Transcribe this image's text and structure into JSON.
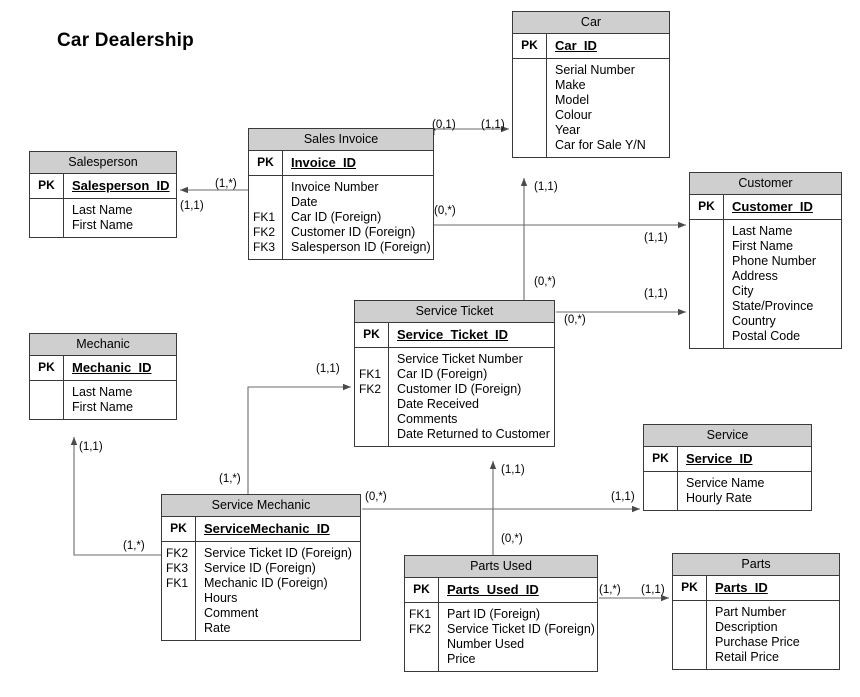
{
  "title": "Car Dealership",
  "colors": {
    "header_fill": "#cfcfcf",
    "border": "#3a3a3a",
    "line": "#6b6b6b",
    "text": "#000000",
    "background": "#ffffff"
  },
  "entities": {
    "salesperson": {
      "name": "Salesperson",
      "pk_tag": "PK",
      "pk_name": "Salesperson_ID",
      "attributes": [
        {
          "key": "",
          "name": "Last Name"
        },
        {
          "key": "",
          "name": "First Name"
        }
      ]
    },
    "sales_invoice": {
      "name": "Sales Invoice",
      "pk_tag": "PK",
      "pk_name": "Invoice_ID",
      "attributes": [
        {
          "key": "",
          "name": "Invoice Number"
        },
        {
          "key": "",
          "name": "Date"
        },
        {
          "key": "FK1",
          "name": "Car ID (Foreign)"
        },
        {
          "key": "FK2",
          "name": "Customer ID (Foreign)"
        },
        {
          "key": "FK3",
          "name": "Salesperson ID (Foreign)"
        }
      ]
    },
    "car": {
      "name": "Car",
      "pk_tag": "PK",
      "pk_name": "Car_ID",
      "attributes": [
        {
          "key": "",
          "name": "Serial Number"
        },
        {
          "key": "",
          "name": "Make"
        },
        {
          "key": "",
          "name": "Model"
        },
        {
          "key": "",
          "name": "Colour"
        },
        {
          "key": "",
          "name": "Year"
        },
        {
          "key": "",
          "name": "Car for Sale Y/N"
        }
      ]
    },
    "customer": {
      "name": "Customer",
      "pk_tag": "PK",
      "pk_name": "Customer_ID",
      "attributes": [
        {
          "key": "",
          "name": "Last Name"
        },
        {
          "key": "",
          "name": "First Name"
        },
        {
          "key": "",
          "name": "Phone Number"
        },
        {
          "key": "",
          "name": "Address"
        },
        {
          "key": "",
          "name": "City"
        },
        {
          "key": "",
          "name": "State/Province"
        },
        {
          "key": "",
          "name": "Country"
        },
        {
          "key": "",
          "name": "Postal Code"
        }
      ]
    },
    "service_ticket": {
      "name": "Service Ticket",
      "pk_tag": "PK",
      "pk_name": "Service_Ticket_ID",
      "attributes": [
        {
          "key": "",
          "name": "Service Ticket Number"
        },
        {
          "key": "FK1",
          "name": "Car ID (Foreign)"
        },
        {
          "key": "FK2",
          "name": "Customer ID (Foreign)"
        },
        {
          "key": "",
          "name": "Date Received"
        },
        {
          "key": "",
          "name": "Comments"
        },
        {
          "key": "",
          "name": "Date Returned to Customer"
        }
      ]
    },
    "mechanic": {
      "name": "Mechanic",
      "pk_tag": "PK",
      "pk_name": "Mechanic_ID",
      "attributes": [
        {
          "key": "",
          "name": "Last Name"
        },
        {
          "key": "",
          "name": "First Name"
        }
      ]
    },
    "service_mechanic": {
      "name": "Service Mechanic",
      "pk_tag": "PK",
      "pk_name": "ServiceMechanic_ID",
      "attributes": [
        {
          "key": "FK2",
          "name": "Service Ticket ID (Foreign)"
        },
        {
          "key": "FK3",
          "name": "Service ID (Foreign)"
        },
        {
          "key": "FK1",
          "name": "Mechanic ID (Foreign)"
        },
        {
          "key": "",
          "name": "Hours"
        },
        {
          "key": "",
          "name": "Comment"
        },
        {
          "key": "",
          "name": "Rate"
        }
      ]
    },
    "service": {
      "name": "Service",
      "pk_tag": "PK",
      "pk_name": "Service_ID",
      "attributes": [
        {
          "key": "",
          "name": "Service Name"
        },
        {
          "key": "",
          "name": "Hourly Rate"
        }
      ]
    },
    "parts_used": {
      "name": "Parts Used",
      "pk_tag": "PK",
      "pk_name": "Parts_Used_ID",
      "attributes": [
        {
          "key": "FK1",
          "name": "Part ID (Foreign)"
        },
        {
          "key": "FK2",
          "name": "Service Ticket ID (Foreign)"
        },
        {
          "key": "",
          "name": "Number Used"
        },
        {
          "key": "",
          "name": "Price"
        }
      ]
    },
    "parts": {
      "name": "Parts",
      "pk_tag": "PK",
      "pk_name": "Parts_ID",
      "attributes": [
        {
          "key": "",
          "name": "Part Number"
        },
        {
          "key": "",
          "name": "Description"
        },
        {
          "key": "",
          "name": "Purchase Price"
        },
        {
          "key": "",
          "name": "Retail Price"
        }
      ]
    }
  },
  "cardinalities": {
    "invoice_to_salesperson_many": "(1,*)",
    "invoice_to_salesperson_one": "(1,1)",
    "invoice_to_car_zero_one": "(0,1)",
    "invoice_to_car_one": "(1,1)",
    "invoice_to_customer_many": "(0,*)",
    "invoice_to_customer_one": "(1,1)",
    "ticket_to_car_many": "(0,*)",
    "ticket_to_car_one": "(1,1)",
    "ticket_to_customer_many": "(0,*)",
    "ticket_to_customer_one": "(1,1)",
    "svcmech_to_ticket_many": "(1,*)",
    "svcmech_to_ticket_one": "(1,1)",
    "svcmech_to_mechanic_many": "(1,*)",
    "svcmech_to_mechanic_one": "(1,1)",
    "svcmech_to_service_many": "(0,*)",
    "svcmech_to_service_one": "(1,1)",
    "partsused_to_ticket_many": "(0,*)",
    "partsused_to_ticket_one": "(1,1)",
    "partsused_to_parts_many": "(1,*)",
    "partsused_to_parts_one": "(1,1)"
  }
}
